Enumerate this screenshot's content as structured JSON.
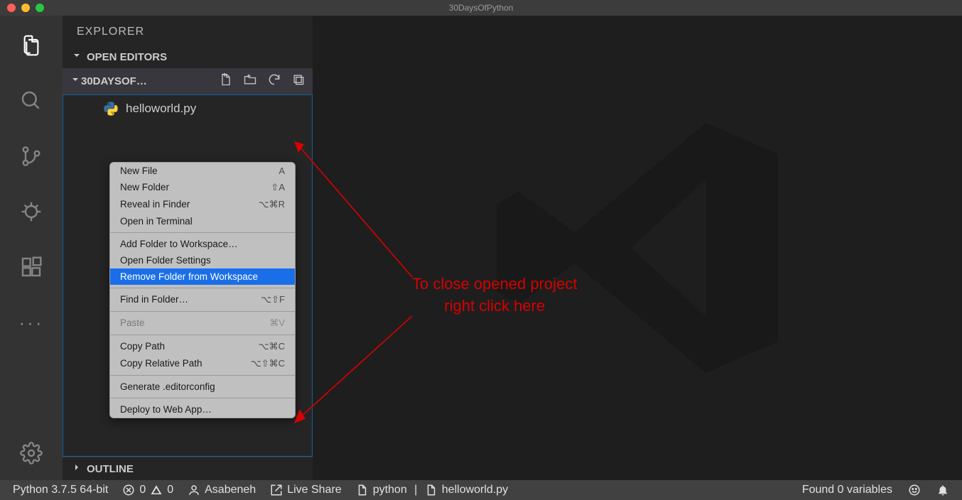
{
  "window": {
    "title": "30DaysOfPython"
  },
  "sidebar": {
    "title": "EXPLORER",
    "open_editors_label": "OPEN EDITORS",
    "workspace_label": "30DAYSOF…",
    "outline_label": "OUTLINE",
    "files": [
      {
        "name": "helloworld.py"
      }
    ]
  },
  "context_menu": {
    "items": [
      {
        "label": "New File",
        "shortcut": "A"
      },
      {
        "label": "New Folder",
        "shortcut": "⇧A"
      },
      {
        "label": "Reveal in Finder",
        "shortcut": "⌥⌘R"
      },
      {
        "label": "Open in Terminal",
        "shortcut": ""
      }
    ],
    "items2": [
      {
        "label": "Add Folder to Workspace…",
        "shortcut": ""
      },
      {
        "label": "Open Folder Settings",
        "shortcut": ""
      },
      {
        "label": "Remove Folder from Workspace",
        "shortcut": "",
        "highlight": true
      }
    ],
    "items3": [
      {
        "label": "Find in Folder…",
        "shortcut": "⌥⇧F"
      }
    ],
    "items4": [
      {
        "label": "Paste",
        "shortcut": "⌘V",
        "disabled": true
      }
    ],
    "items5": [
      {
        "label": "Copy Path",
        "shortcut": "⌥⌘C"
      },
      {
        "label": "Copy Relative Path",
        "shortcut": "⌥⇧⌘C"
      }
    ],
    "items6": [
      {
        "label": "Generate .editorconfig",
        "shortcut": ""
      }
    ],
    "items7": [
      {
        "label": "Deploy to Web App…",
        "shortcut": ""
      }
    ]
  },
  "annotation": {
    "line1": "To close opened project",
    "line2": "right click here"
  },
  "status": {
    "python": "Python 3.7.5 64-bit",
    "errors": "0",
    "warnings": "0",
    "user": "Asabeneh",
    "live_share": "Live Share",
    "lang": "python",
    "file": "helloworld.py",
    "variables": "Found 0 variables"
  }
}
